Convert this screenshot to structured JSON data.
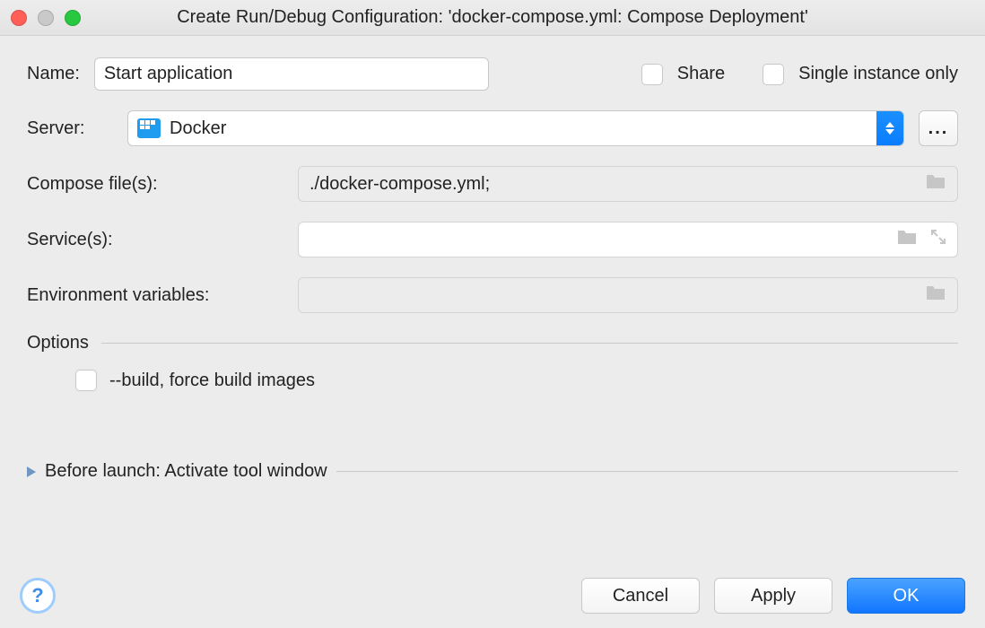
{
  "titlebar": {
    "title": "Create Run/Debug Configuration: 'docker-compose.yml: Compose Deployment'"
  },
  "form": {
    "name_label": "Name:",
    "name_value": "Start application",
    "share_label": "Share",
    "single_instance_label": "Single instance only",
    "server_label": "Server:",
    "server_value": "Docker",
    "server_ellipsis": "...",
    "compose_label": "Compose file(s):",
    "compose_value": "./docker-compose.yml;",
    "services_label": "Service(s):",
    "services_value": "",
    "env_label": "Environment variables:",
    "env_value": ""
  },
  "options": {
    "heading": "Options",
    "build_label": "--build, force build images"
  },
  "before_launch": {
    "heading": "Before launch: Activate tool window"
  },
  "footer": {
    "cancel": "Cancel",
    "apply": "Apply",
    "ok": "OK",
    "help": "?"
  }
}
